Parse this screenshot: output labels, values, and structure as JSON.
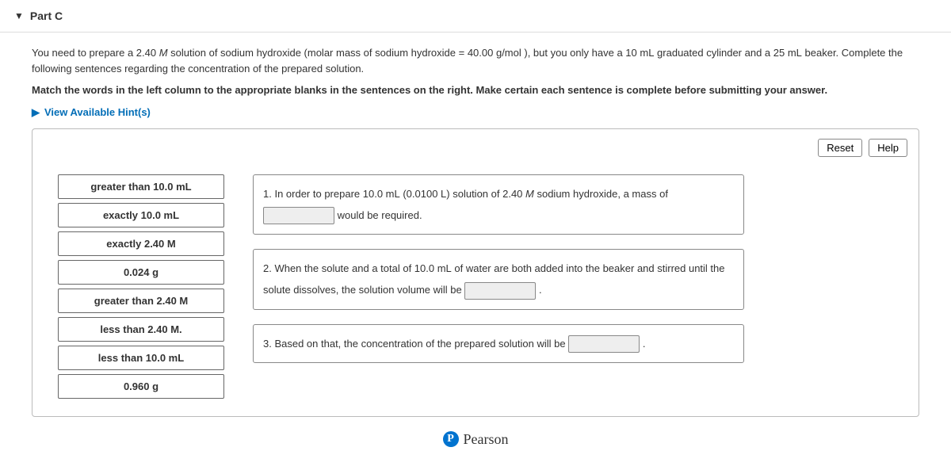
{
  "header": {
    "title": "Part C"
  },
  "intro": {
    "p1a": "You need to prepare a 2.40 ",
    "p1b": " solution of sodium hydroxide (molar mass of sodium hydroxide = 40.00 ",
    "unit_gmol": "g/mol",
    "p1c": " ), but you only have a 10 ",
    "unit_ml": "mL",
    "p1d": " graduated cylinder and a 25 ",
    "p1e": " beaker. Complete the following sentences regarding the concentration of the prepared solution.",
    "M_italic": "M",
    "p2": "Match the words in the left column to the appropriate blanks in the sentences on the right. Make certain each sentence is complete before submitting your answer."
  },
  "hints": {
    "label": "View Available Hint(s)"
  },
  "toolbar": {
    "reset": "Reset",
    "help": "Help"
  },
  "choices": [
    "greater than 10.0 mL",
    "exactly 10.0 mL",
    "exactly 2.40 M",
    "0.024 g",
    "greater than 2.40 M",
    "less than 2.40 M.",
    "less than 10.0 mL",
    "0.960 g"
  ],
  "sentences": {
    "s1a": "1. In order to prepare 10.0 ",
    "s1b": " (0.0100 ",
    "unit_L": "L",
    "s1c": ") solution of 2.40 ",
    "s1d": " sodium hydroxide, a mass of ",
    "s1e": " would be required.",
    "s2a": "2. When the solute and a total of 10.0 ",
    "s2b": " of water are both added into the beaker and stirred until the solute dissolves, the solution volume will be ",
    "s2c": " .",
    "s3a": "3. Based on that, the concentration of the prepared solution will be ",
    "s3b": " ."
  },
  "footer": {
    "brand": "Pearson",
    "logo_letter": "P"
  }
}
